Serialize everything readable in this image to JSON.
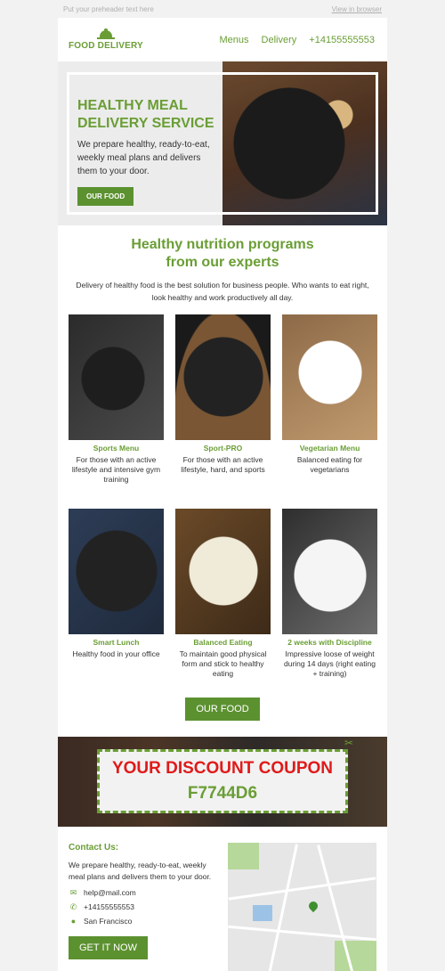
{
  "preheader": {
    "text": "Put your preheader text here",
    "link": "View in browser"
  },
  "header": {
    "logo": "FOOD DELIVERY",
    "nav": [
      "Menus",
      "Delivery",
      "+14155555553"
    ]
  },
  "hero": {
    "title": "HEALTHY MEAL DELIVERY SERVICE",
    "description": "We prepare healthy, ready-to-eat, weekly meal plans and delivers them to your door.",
    "button": "OUR FOOD"
  },
  "programs": {
    "title_line1": "Healthy nutrition programs",
    "title_line2": "from our experts",
    "subtitle": "Delivery of healthy food is the best solution for business people. Who wants to eat right, look healthy and work productively all day.",
    "items": [
      {
        "name": "Sports Menu",
        "desc": "For those with an active lifestyle and intensive gym training"
      },
      {
        "name": "Sport-PRO",
        "desc": "For those with an active lifestyle, hard, and sports"
      },
      {
        "name": "Vegetarian Menu",
        "desc": "Balanced eating for vegetarians"
      },
      {
        "name": "Smart Lunch",
        "desc": "Healthy food in your office"
      },
      {
        "name": "Balanced Eating",
        "desc": "To maintain good physical form and stick to healthy eating"
      },
      {
        "name": "2 weeks with Discipline",
        "desc": "Impressive loose of weight during 14 days (right eating + training)"
      }
    ],
    "button": "OUR FOOD"
  },
  "coupon": {
    "title": "YOUR DISCOUNT COUPON",
    "code": "F7744D6"
  },
  "contact": {
    "title": "Contact Us:",
    "description": "We prepare healthy, ready-to-eat, weekly meal plans and delivers them to your door.",
    "email": "help@mail.com",
    "phone": "+14155555553",
    "location": "San Francisco",
    "button": "GET IT NOW"
  },
  "colors": {
    "accent": "#6a9e35",
    "button": "#5c9130",
    "coupon_red": "#e01a1a"
  }
}
